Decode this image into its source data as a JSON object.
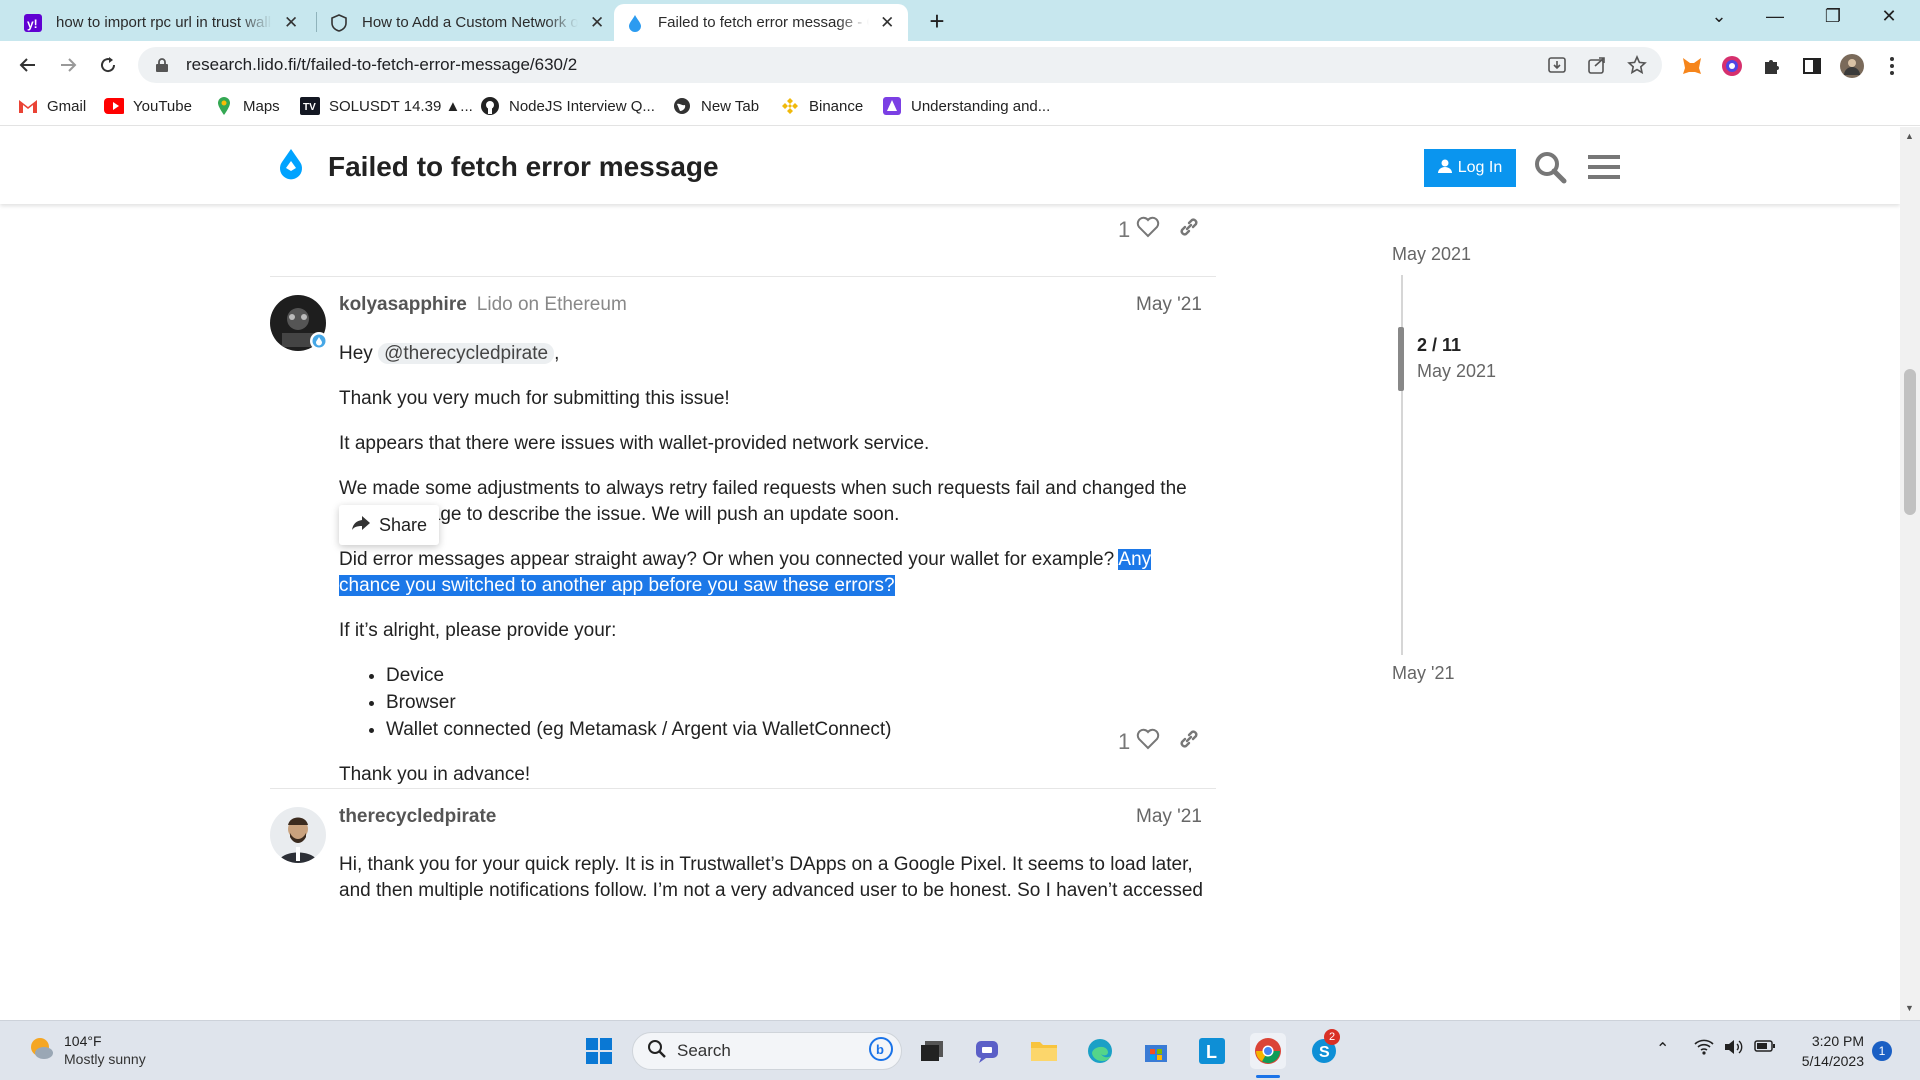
{
  "browser": {
    "tabs": [
      {
        "title": "how to import rpc url in trust wallet",
        "favicon": "yahoo-icon",
        "active": false
      },
      {
        "title": "How to Add a Custom Network on",
        "favicon": "shield-icon",
        "active": false
      },
      {
        "title": "Failed to fetch error message - Gov",
        "favicon": "lido-drop-icon",
        "active": true
      }
    ],
    "url": "research.lido.fi/t/failed-to-fetch-error-message/630/2",
    "bookmarks": [
      {
        "label": "Gmail",
        "icon": "gmail-icon"
      },
      {
        "label": "YouTube",
        "icon": "youtube-icon"
      },
      {
        "label": "Maps",
        "icon": "maps-icon"
      },
      {
        "label": "SOLUSDT 14.39 ▲...",
        "icon": "tradingview-icon"
      },
      {
        "label": "NodeJS Interview Q...",
        "icon": "github-icon"
      },
      {
        "label": "New Tab",
        "icon": "globe-icon"
      },
      {
        "label": "Binance",
        "icon": "binance-icon"
      },
      {
        "label": "Understanding and...",
        "icon": "bookmark-app-icon"
      }
    ]
  },
  "site": {
    "title": "Failed to fetch error message",
    "login_label": "Log In"
  },
  "post1_footer": {
    "likes": "1"
  },
  "post2": {
    "username": "kolyasapphire",
    "user_title": "Lido on Ethereum",
    "date": "May '21",
    "greeting": "Hey",
    "mention": "@therecycledpirate",
    "comma": ",",
    "p1": "Thank you very much for submitting this issue!",
    "p2": "It appears that there were issues with wallet-provided network service.",
    "p3": "We made some adjustments to always retry failed requests when such requests fail and changed the error message to describe the issue. We will push an update soon.",
    "p4_plain": "Did error messages appear straight away? Or when you connected your wallet for example?",
    "p4_selected": "Any chance you switched to another app before you saw these errors?",
    "p5": "If it’s alright, please provide your:",
    "list": [
      "Device",
      "Browser",
      "Wallet connected (eg Metamask / Argent via WalletConnect)"
    ],
    "p6": "Thank you in advance!",
    "likes": "1",
    "share_label": "Share"
  },
  "post3": {
    "username": "therecycledpirate",
    "date": "May '21",
    "text": "Hi, thank you for your quick reply. It is in Trustwallet’s DApps on a Google Pixel. It seems to load later, and then multiple notifications follow. I’m not a very advanced user to be honest. So I haven’t accessed"
  },
  "timeline": {
    "start": "May 2021",
    "position": "2 / 11",
    "position_date": "May 2021",
    "end": "May '21"
  },
  "taskbar": {
    "temperature": "104°F",
    "weather": "Mostly sunny",
    "search_label": "Search",
    "store_badge": "2",
    "time": "3:20 PM",
    "date": "5/14/2023",
    "notifications": "1"
  },
  "colors": {
    "accent": "#0a95ef",
    "selection": "#1c78e8",
    "tabbar": "#c7e7ee"
  }
}
